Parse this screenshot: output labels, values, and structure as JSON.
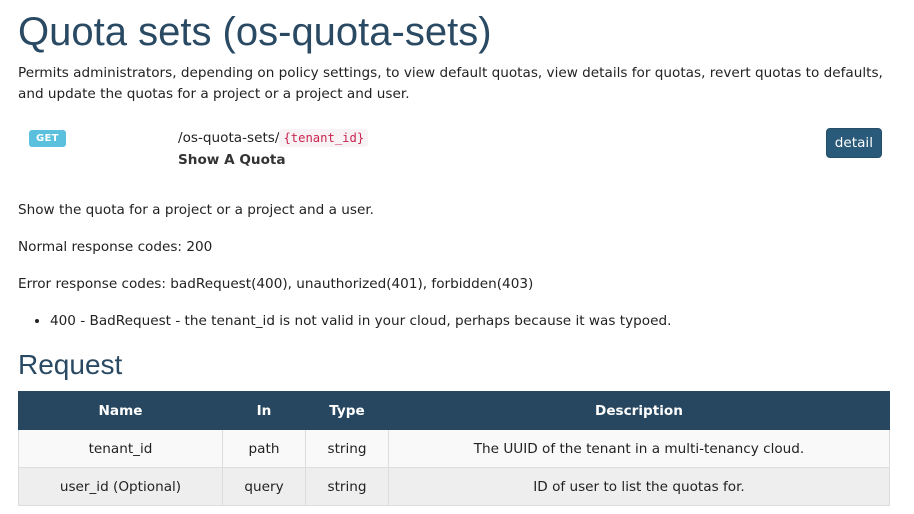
{
  "page": {
    "title": "Quota sets (os-quota-sets)",
    "intro": "Permits administrators, depending on policy settings, to view default quotas, view details for quotas, revert quotas to defaults, and update the quotas for a project or a project and user."
  },
  "endpoint": {
    "method": "GET",
    "path_prefix": "/os-quota-sets/",
    "path_param": "{tenant_id}",
    "summary": "Show A Quota",
    "detail_label": "detail",
    "badge_color": "#5bc0de",
    "button_color": "#2a5a7a"
  },
  "description": {
    "text": "Show the quota for a project or a project and a user.",
    "normal_codes": "Normal response codes: 200",
    "error_codes": "Error response codes: badRequest(400), unauthorized(401), forbidden(403)",
    "bullets": [
      "400 - BadRequest - the tenant_id is not valid in your cloud, perhaps because it was typoed."
    ]
  },
  "request": {
    "title": "Request",
    "header_color": "#26475f",
    "columns": [
      "Name",
      "In",
      "Type",
      "Description"
    ],
    "rows": [
      {
        "name": "tenant_id",
        "in": "path",
        "type": "string",
        "description": "The UUID of the tenant in a multi-tenancy cloud."
      },
      {
        "name": "user_id (Optional)",
        "in": "query",
        "type": "string",
        "description": "ID of user to list the quotas for."
      }
    ]
  }
}
